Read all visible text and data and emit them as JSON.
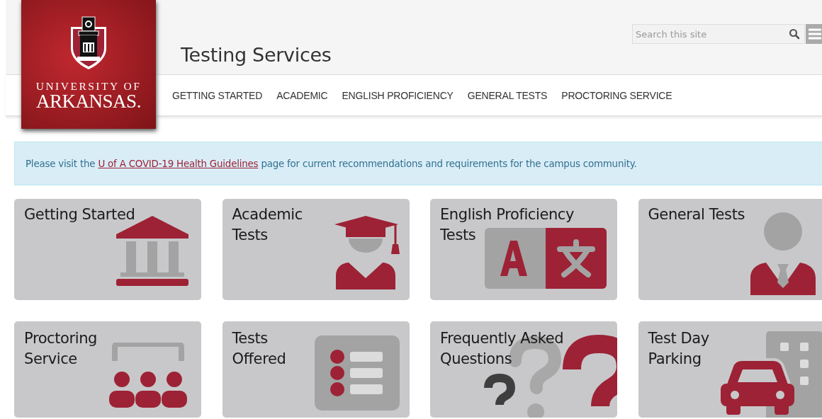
{
  "logo": {
    "line_1": "UNIVERSITY OF",
    "line_2": "ARKANSAS."
  },
  "site_title": "Testing Services",
  "search": {
    "placeholder": "Search this site"
  },
  "nav": [
    {
      "label": "GETTING STARTED"
    },
    {
      "label": "ACADEMIC"
    },
    {
      "label": "ENGLISH PROFICIENCY"
    },
    {
      "label": "GENERAL TESTS"
    },
    {
      "label": "PROCTORING SERVICE"
    }
  ],
  "alert": {
    "before": "Please visit the ",
    "link": "U of A COVID-19 Health Guidelines",
    "after": " page for current recommendations and requirements for the campus community."
  },
  "tiles": [
    {
      "title": "Getting Started",
      "kind": "building"
    },
    {
      "title": "Academic\nTests",
      "kind": "graduate"
    },
    {
      "title": "English Proficiency\nTests",
      "kind": "translate"
    },
    {
      "title": "General Tests",
      "kind": "person"
    },
    {
      "title": "Proctoring\nService",
      "kind": "group"
    },
    {
      "title": "Tests\nOffered",
      "kind": "list"
    },
    {
      "title": "Frequently Asked\nQuestions",
      "kind": "questions"
    },
    {
      "title": "Test Day\nParking",
      "kind": "parking"
    }
  ]
}
